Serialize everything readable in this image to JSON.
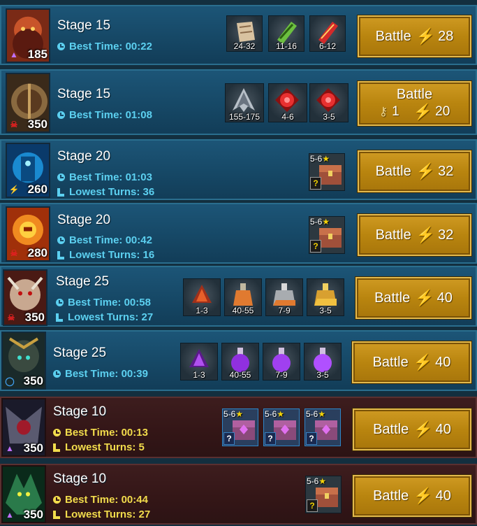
{
  "stages": [
    {
      "title": "Stage 15",
      "level": "185",
      "rank_icon": "triangle-icon",
      "theme": "blue",
      "best_time": "Best Time: 00:22",
      "lowest_turns": null,
      "rewards": [
        {
          "icon": "scroll-icon",
          "qty": "24-32"
        },
        {
          "icon": "green-scroll-icon",
          "qty": "11-16"
        },
        {
          "icon": "red-scroll-icon",
          "qty": "6-12"
        }
      ],
      "chests": [],
      "battle": {
        "label": "Battle",
        "energy": "28",
        "keys": null
      }
    },
    {
      "title": "Stage 15",
      "level": "350",
      "rank_icon": "skull-icon",
      "theme": "blue",
      "best_time": "Best Time: 01:08",
      "lowest_turns": null,
      "rewards": [
        {
          "icon": "grey-shard-icon",
          "qty": "155-175"
        },
        {
          "icon": "red-gem-icon",
          "qty": "4-6"
        },
        {
          "icon": "red-gem-icon",
          "qty": "3-5"
        }
      ],
      "chests": [],
      "battle": {
        "label": "Battle",
        "energy": "20",
        "keys": "1"
      }
    },
    {
      "title": "Stage 20",
      "level": "260",
      "rank_icon": "bolt-icon",
      "theme": "blue",
      "best_time": "Best Time: 01:03",
      "lowest_turns": "Lowest Turns: 36",
      "rewards": [],
      "chests": [
        {
          "stars": "5-6",
          "q": "?"
        }
      ],
      "battle": {
        "label": "Battle",
        "energy": "32",
        "keys": null
      }
    },
    {
      "title": "Stage 20",
      "level": "280",
      "rank_icon": "skull-icon",
      "theme": "blue",
      "best_time": "Best Time: 00:42",
      "lowest_turns": "Lowest Turns: 16",
      "rewards": [],
      "chests": [
        {
          "stars": "5-6",
          "q": "?"
        }
      ],
      "battle": {
        "label": "Battle",
        "energy": "32",
        "keys": null
      }
    },
    {
      "title": "Stage 25",
      "level": "350",
      "rank_icon": "skull-icon",
      "theme": "blue",
      "best_time": "Best Time: 00:58",
      "lowest_turns": "Lowest Turns: 27",
      "rewards": [
        {
          "icon": "red-shard-icon",
          "qty": "1-3"
        },
        {
          "icon": "orange-potion-icon",
          "qty": "40-55"
        },
        {
          "icon": "grey-potion-icon",
          "qty": "7-9"
        },
        {
          "icon": "gold-potion-icon",
          "qty": "3-5"
        }
      ],
      "chests": [],
      "battle": {
        "label": "Battle",
        "energy": "40",
        "keys": null
      }
    },
    {
      "title": "Stage 25",
      "level": "350",
      "rank_icon": "circle-icon",
      "theme": "blue",
      "best_time": "Best Time: 00:39",
      "lowest_turns": null,
      "rewards": [
        {
          "icon": "purple-shard-icon",
          "qty": "1-3"
        },
        {
          "icon": "purple-potion-icon",
          "qty": "40-55"
        },
        {
          "icon": "purple-potion-icon",
          "qty": "7-9"
        },
        {
          "icon": "purple-potion-icon",
          "qty": "3-5"
        }
      ],
      "chests": [],
      "battle": {
        "label": "Battle",
        "energy": "40",
        "keys": null
      }
    },
    {
      "title": "Stage 10",
      "level": "350",
      "rank_icon": "triangle-icon",
      "theme": "dark",
      "best_time": "Best Time: 00:13",
      "lowest_turns": "Lowest Turns: 5",
      "rewards": [],
      "chests": [
        {
          "stars": "5-6",
          "q": "?"
        },
        {
          "stars": "5-6",
          "q": "?"
        },
        {
          "stars": "5-6",
          "q": "?"
        }
      ],
      "battle": {
        "label": "Battle",
        "energy": "40",
        "keys": null
      }
    },
    {
      "title": "Stage 10",
      "level": "350",
      "rank_icon": "triangle-icon",
      "theme": "dark",
      "best_time": "Best Time: 00:44",
      "lowest_turns": "Lowest Turns: 27",
      "rewards": [],
      "chests": [
        {
          "stars": "5-6",
          "q": "?"
        }
      ],
      "battle": {
        "label": "Battle",
        "energy": "40",
        "keys": null
      }
    }
  ],
  "colors": {
    "accent_blue": "#5cd0f0",
    "accent_yellow": "#f2dc4c",
    "battle_gold": "#c08f18",
    "energy": "#e8f020"
  }
}
